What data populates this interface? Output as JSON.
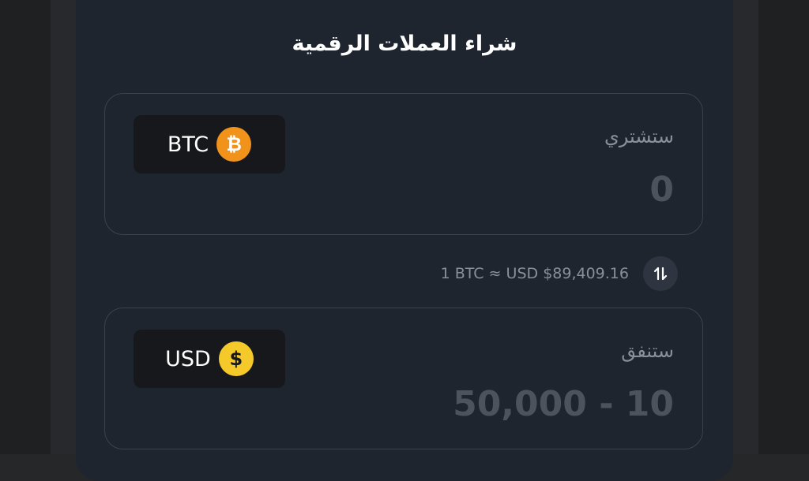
{
  "title": "شراء العملات الرقمية",
  "buy": {
    "label": "ستشتري",
    "value": "0",
    "currency": "BTC",
    "coin_symbol": "₿",
    "coin_color": "#f1931a",
    "coin_icon": "bitcoin-icon"
  },
  "rate": {
    "text": "1 BTC ≈ USD $89,409.16"
  },
  "spend": {
    "label": "ستنفق",
    "placeholder": "50,000 - 10",
    "currency": "USD",
    "coin_symbol": "$",
    "coin_color": "#f6c92b",
    "coin_icon": "dollar-icon"
  },
  "colors": {
    "panel": "#1f252e",
    "accent_btc": "#f1931a",
    "accent_usd": "#f6c92b"
  }
}
